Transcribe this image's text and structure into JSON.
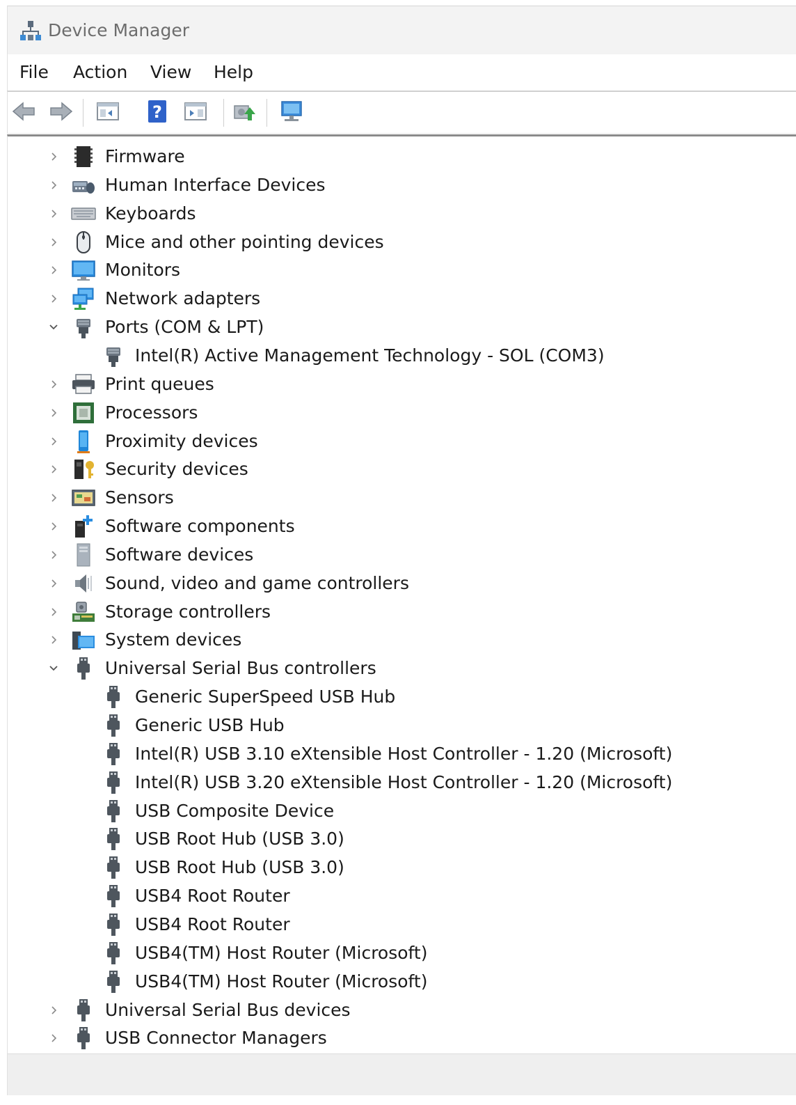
{
  "window": {
    "title": "Device Manager"
  },
  "menu": [
    {
      "label": "File"
    },
    {
      "label": "Action"
    },
    {
      "label": "View"
    },
    {
      "label": "Help"
    }
  ],
  "toolbar": [
    {
      "icon": "back-arrow-icon"
    },
    {
      "icon": "forward-arrow-icon"
    },
    {
      "icon": "show-hide-console-tree-icon"
    },
    {
      "icon": "help-icon"
    },
    {
      "icon": "show-hide-action-pane-icon"
    },
    {
      "icon": "update-driver-icon"
    },
    {
      "icon": "scan-hardware-changes-icon"
    }
  ],
  "tree": [
    {
      "label": "Firmware",
      "level": 0,
      "state": "collapsed",
      "icon": "firmware-chip-icon"
    },
    {
      "label": "Human Interface Devices",
      "level": 0,
      "state": "collapsed",
      "icon": "hid-icon"
    },
    {
      "label": "Keyboards",
      "level": 0,
      "state": "collapsed",
      "icon": "keyboard-icon"
    },
    {
      "label": "Mice and other pointing devices",
      "level": 0,
      "state": "collapsed",
      "icon": "mouse-icon"
    },
    {
      "label": "Monitors",
      "level": 0,
      "state": "collapsed",
      "icon": "monitor-icon"
    },
    {
      "label": "Network adapters",
      "level": 0,
      "state": "collapsed",
      "icon": "network-adapter-icon"
    },
    {
      "label": "Ports (COM & LPT)",
      "level": 0,
      "state": "expanded",
      "icon": "port-connector-icon"
    },
    {
      "label": "Intel(R) Active Management Technology - SOL (COM3)",
      "level": 1,
      "state": "leaf",
      "icon": "port-connector-icon"
    },
    {
      "label": "Print queues",
      "level": 0,
      "state": "collapsed",
      "icon": "printer-icon"
    },
    {
      "label": "Processors",
      "level": 0,
      "state": "collapsed",
      "icon": "processor-icon"
    },
    {
      "label": "Proximity devices",
      "level": 0,
      "state": "collapsed",
      "icon": "proximity-device-icon"
    },
    {
      "label": "Security devices",
      "level": 0,
      "state": "collapsed",
      "icon": "security-key-icon"
    },
    {
      "label": "Sensors",
      "level": 0,
      "state": "collapsed",
      "icon": "sensor-icon"
    },
    {
      "label": "Software components",
      "level": 0,
      "state": "collapsed",
      "icon": "software-component-icon"
    },
    {
      "label": "Software devices",
      "level": 0,
      "state": "collapsed",
      "icon": "software-device-icon"
    },
    {
      "label": "Sound, video and game controllers",
      "level": 0,
      "state": "collapsed",
      "icon": "speaker-icon"
    },
    {
      "label": "Storage controllers",
      "level": 0,
      "state": "collapsed",
      "icon": "storage-controller-icon"
    },
    {
      "label": "System devices",
      "level": 0,
      "state": "collapsed",
      "icon": "system-folder-icon"
    },
    {
      "label": "Universal Serial Bus controllers",
      "level": 0,
      "state": "expanded",
      "icon": "usb-plug-icon"
    },
    {
      "label": "Generic SuperSpeed USB Hub",
      "level": 1,
      "state": "leaf",
      "icon": "usb-plug-icon"
    },
    {
      "label": "Generic USB Hub",
      "level": 1,
      "state": "leaf",
      "icon": "usb-plug-icon"
    },
    {
      "label": "Intel(R) USB 3.10 eXtensible Host Controller - 1.20 (Microsoft)",
      "level": 1,
      "state": "leaf",
      "icon": "usb-plug-icon"
    },
    {
      "label": "Intel(R) USB 3.20 eXtensible Host Controller - 1.20 (Microsoft)",
      "level": 1,
      "state": "leaf",
      "icon": "usb-plug-icon"
    },
    {
      "label": "USB Composite Device",
      "level": 1,
      "state": "leaf",
      "icon": "usb-plug-icon"
    },
    {
      "label": "USB Root Hub (USB 3.0)",
      "level": 1,
      "state": "leaf",
      "icon": "usb-plug-icon"
    },
    {
      "label": "USB Root Hub (USB 3.0)",
      "level": 1,
      "state": "leaf",
      "icon": "usb-plug-icon"
    },
    {
      "label": "USB4 Root Router",
      "level": 1,
      "state": "leaf",
      "icon": "usb-plug-icon"
    },
    {
      "label": "USB4 Root Router",
      "level": 1,
      "state": "leaf",
      "icon": "usb-plug-icon"
    },
    {
      "label": "USB4(TM) Host Router (Microsoft)",
      "level": 1,
      "state": "leaf",
      "icon": "usb-plug-icon"
    },
    {
      "label": "USB4(TM) Host Router (Microsoft)",
      "level": 1,
      "state": "leaf",
      "icon": "usb-plug-icon"
    },
    {
      "label": "Universal Serial Bus devices",
      "level": 0,
      "state": "collapsed",
      "icon": "usb-plug-icon"
    },
    {
      "label": "USB Connector Managers",
      "level": 0,
      "state": "collapsed",
      "icon": "usb-plug-icon"
    }
  ]
}
